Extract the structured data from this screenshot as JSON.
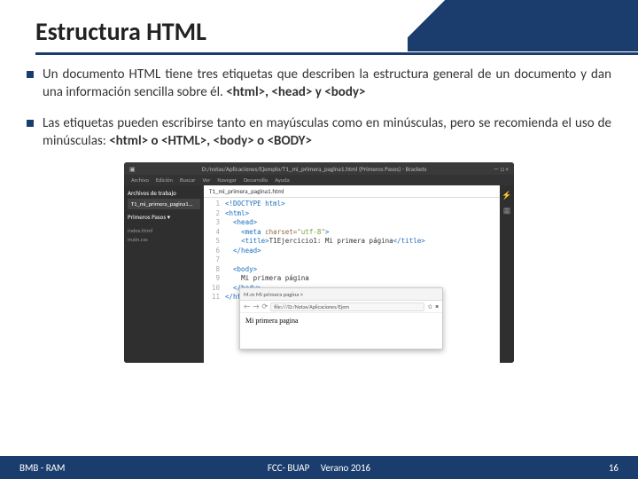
{
  "title": "Estructura HTML",
  "bullets": [
    {
      "pre": "Un documento HTML tiene tres etiquetas que describen la estructura general de un documento y dan una información sencilla sobre él. ",
      "bold": "<html>, <head> y <body>"
    },
    {
      "pre": "Las etiquetas pueden escribirse tanto en mayúsculas como en minúsculas, pero se recomienda el uso de minúsculas: ",
      "bold": "<html> o <HTML>, <body> o <BODY>"
    }
  ],
  "editor": {
    "titlebar_path": "D:/notas/Aplicaciones/Ejemplo/T1_mi_primera_pagina1.html (Primeros Pasos) - Brackets",
    "menu": [
      "Archivo",
      "Edición",
      "Buscar",
      "Ver",
      "Navegar",
      "Desarrollo",
      "Ayuda"
    ],
    "sidebar": {
      "section": "Archivos de trabajo",
      "active_file": "T1_mi_primera_pagina1...",
      "project": "Primeros Pasos ▾",
      "files": [
        "index.html",
        "main.css"
      ]
    },
    "filetab": "T1_mi_primera_pagina1.html",
    "code": [
      {
        "n": "1",
        "html": "<span class='tag'>&lt;!DOCTYPE html&gt;</span>"
      },
      {
        "n": "2",
        "html": "<span class='tag'>&lt;html&gt;</span>"
      },
      {
        "n": "3",
        "html": "&nbsp;&nbsp;<span class='tag'>&lt;head&gt;</span>"
      },
      {
        "n": "4",
        "html": "&nbsp;&nbsp;&nbsp;&nbsp;<span class='tag'>&lt;meta</span> <span class='attr'>charset=</span><span class='str'>\"utf-8\"</span><span class='tag'>&gt;</span>"
      },
      {
        "n": "5",
        "html": "&nbsp;&nbsp;&nbsp;&nbsp;<span class='tag'>&lt;title&gt;</span><span class='txt2'>T1Ejercicio1: Mi primera p&aacute;gina</span><span class='tag'>&lt;/title&gt;</span>"
      },
      {
        "n": "6",
        "html": "&nbsp;&nbsp;<span class='tag'>&lt;/head&gt;</span>"
      },
      {
        "n": "7",
        "html": ""
      },
      {
        "n": "8",
        "html": "&nbsp;&nbsp;<span class='tag'>&lt;body&gt;</span>"
      },
      {
        "n": "9",
        "html": "&nbsp;&nbsp;&nbsp;&nbsp;<span class='txt2'>Mi primera p&aacute;gina</span>"
      },
      {
        "n": "10",
        "html": "&nbsp;&nbsp;<span class='tag'>&lt;/body&gt;</span>"
      },
      {
        "n": "11",
        "html": "<span class='tag'>&lt;/html&gt;</span>"
      }
    ],
    "browser": {
      "tab": "M.m  Mi primera pagina   ×",
      "url": "file:///D:/Notas/Aplicaciones/Ejem",
      "body": "Mi primera pagina"
    }
  },
  "footer": {
    "left": "BMB - RAM",
    "center_left": "FCC- BUAP",
    "center_right": "Verano 2016",
    "page": "16"
  }
}
